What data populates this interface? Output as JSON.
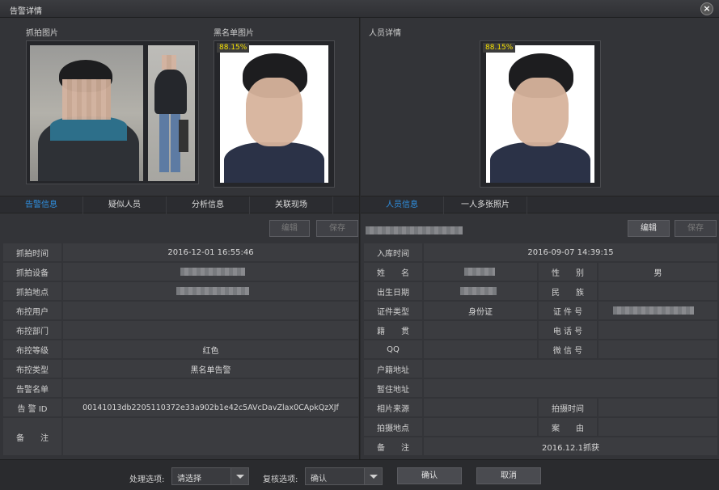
{
  "window": {
    "title": "告警详情"
  },
  "left": {
    "capture_label": "抓拍图片",
    "blacklist_label": "黑名单图片",
    "blacklist_score": "88.15%",
    "tabs": [
      "告警信息",
      "疑似人员",
      "分析信息",
      "关联现场"
    ],
    "edit_label": "编辑",
    "save_label": "保存",
    "rows": [
      {
        "label": "抓拍时间",
        "value": "2016-12-01 16:55:46"
      },
      {
        "label": "抓拍设备",
        "value": ""
      },
      {
        "label": "抓拍地点",
        "value": ""
      },
      {
        "label": "布控用户",
        "value": ""
      },
      {
        "label": "布控部门",
        "value": ""
      },
      {
        "label": "布控等级",
        "value": "红色"
      },
      {
        "label": "布控类型",
        "value": "黑名单告警"
      },
      {
        "label": "告警名单",
        "value": ""
      },
      {
        "label": "告 警 ID",
        "value": "00141013db2205110372e33a902b1e42c5AVcDavZlax0CApkQzXJf"
      },
      {
        "label": "备　　注",
        "value": ""
      }
    ]
  },
  "right": {
    "person_label": "人员详情",
    "score": "88.15%",
    "tabs": [
      "人员信息",
      "一人多张照片"
    ],
    "edit_label": "编辑",
    "save_label": "保存",
    "entry_time_label": "入库时间",
    "entry_time": "2016-09-07 14:39:15",
    "rows": [
      {
        "l1": "姓　　名",
        "v1": "",
        "l2": "性　　别",
        "v2": "男"
      },
      {
        "l1": "出生日期",
        "v1": "",
        "l2": "民　　族",
        "v2": ""
      },
      {
        "l1": "证件类型",
        "v1": "身份证",
        "l2": "证 件 号",
        "v2": ""
      },
      {
        "l1": "籍　　贯",
        "v1": "",
        "l2": "电 话 号",
        "v2": ""
      },
      {
        "l1": "QQ",
        "v1": "",
        "l2": "微 信 号",
        "v2": ""
      }
    ],
    "household_label": "户籍地址",
    "temp_label": "暂住地址",
    "photo_source_label": "相片来源",
    "shoot_time_label": "拍摄时间",
    "shoot_place_label": "拍摄地点",
    "case_label": "案　　由",
    "remark_label": "备　　注",
    "remark_value": "2016.12.1抓获"
  },
  "bottom": {
    "process_label": "处理选项:",
    "process_value": "请选择",
    "review_label": "复核选项:",
    "review_value": "确认",
    "confirm_label": "确认",
    "cancel_label": "取消"
  },
  "colors": {
    "accent": "#2f8fe0",
    "score_text": "#f5e000"
  }
}
